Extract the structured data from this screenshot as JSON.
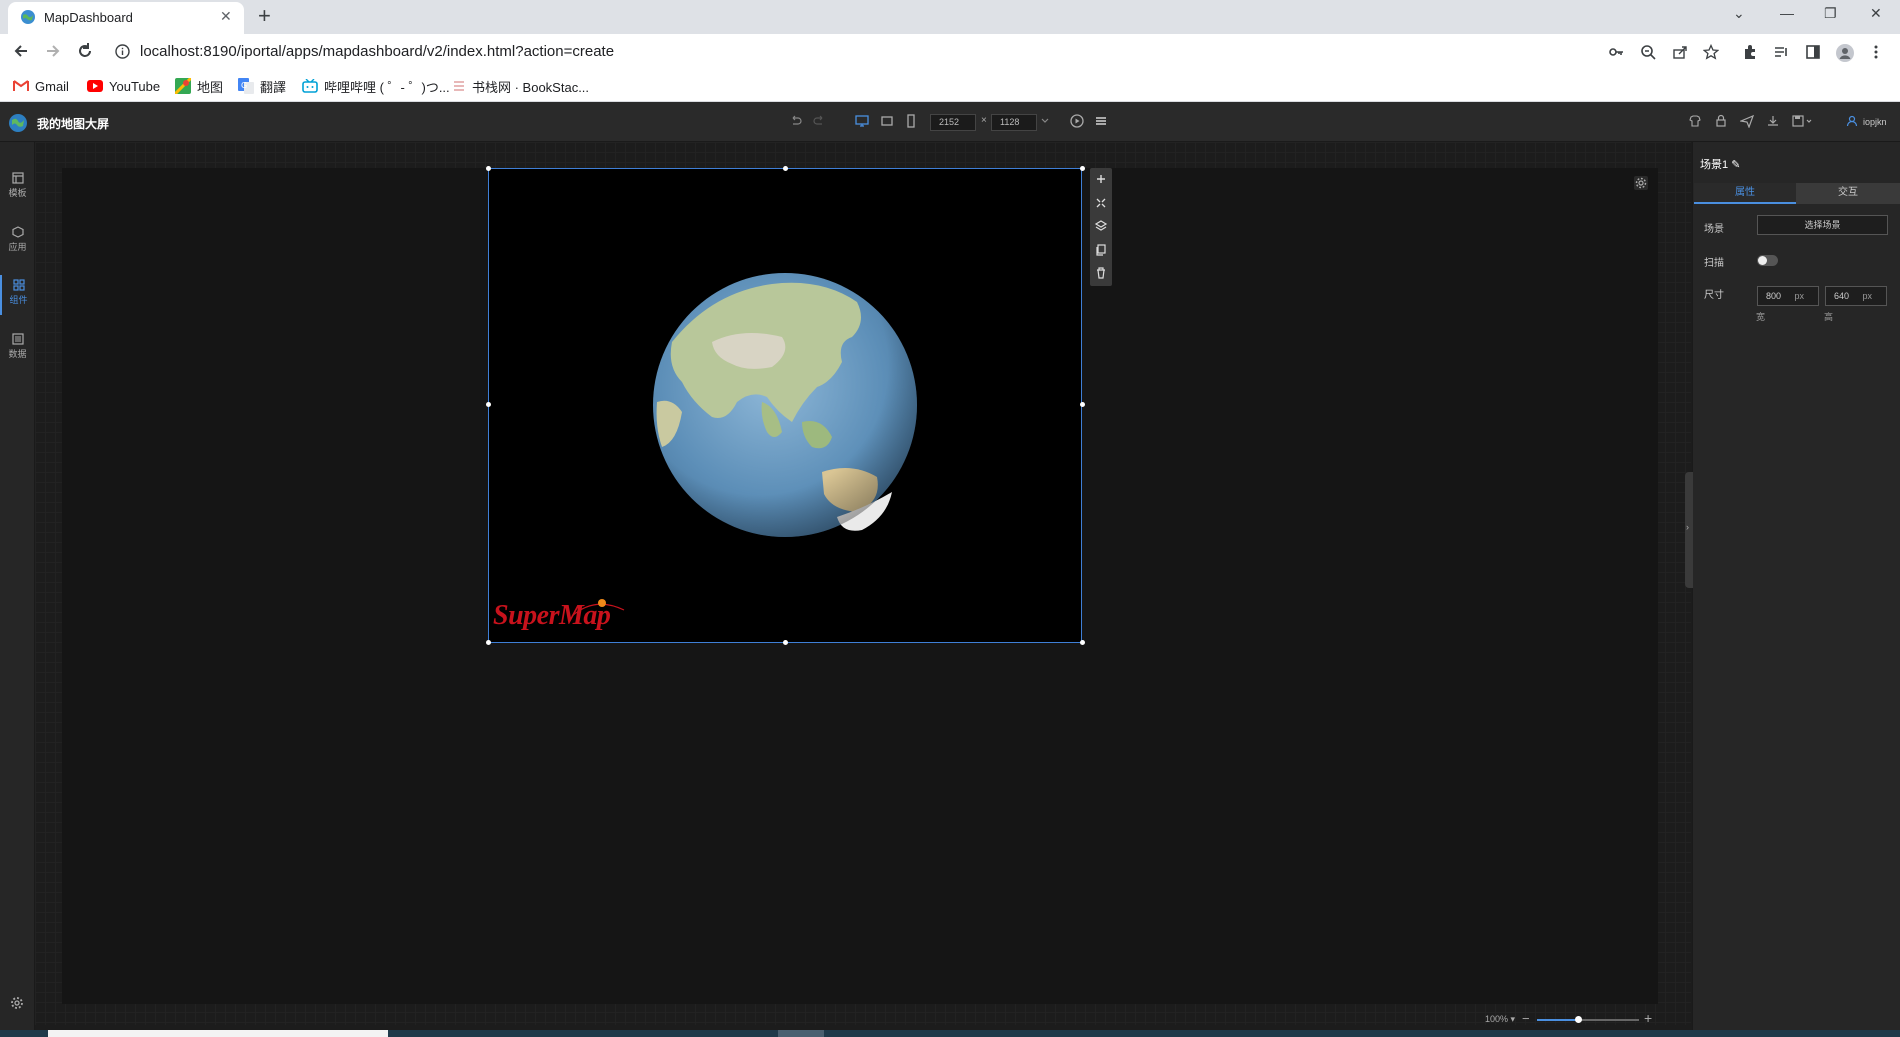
{
  "browser": {
    "tab_title": "MapDashboard",
    "url": "localhost:8190/iportal/apps/mapdashboard/v2/index.html?action=create",
    "bookmarks": [
      "Gmail",
      "YouTube",
      "地图",
      "翻譯",
      "哔哩哔哩 ( ゜- ゜)つ...",
      "书栈网 · BookStac..."
    ]
  },
  "app": {
    "title": "我的地图大屏",
    "width_value": "2152",
    "height_value": "1128",
    "times": "×",
    "user": "iopjkn"
  },
  "left_nav": [
    {
      "label": "模板",
      "icon": "template-icon"
    },
    {
      "label": "应用",
      "icon": "app-icon"
    },
    {
      "label": "组件",
      "icon": "component-icon"
    },
    {
      "label": "数据",
      "icon": "data-icon"
    }
  ],
  "scene": {
    "logo_text": "SuperMap"
  },
  "panel": {
    "title": "场景1",
    "tab_attributes": "属性",
    "tab_interaction": "交互",
    "scene_label": "场景",
    "choose_scene": "选择场景",
    "scan_label": "扫描",
    "scan_enabled": false,
    "size_label": "尺寸",
    "width": "800",
    "height": "640",
    "unit": "px",
    "width_caption": "宽",
    "height_caption": "高"
  },
  "zoom": {
    "value": "100%",
    "level": 0.4
  },
  "colors": {
    "accent": "#4a8fe0",
    "logo_red": "#c8121c",
    "background": "#1c1c1c"
  }
}
